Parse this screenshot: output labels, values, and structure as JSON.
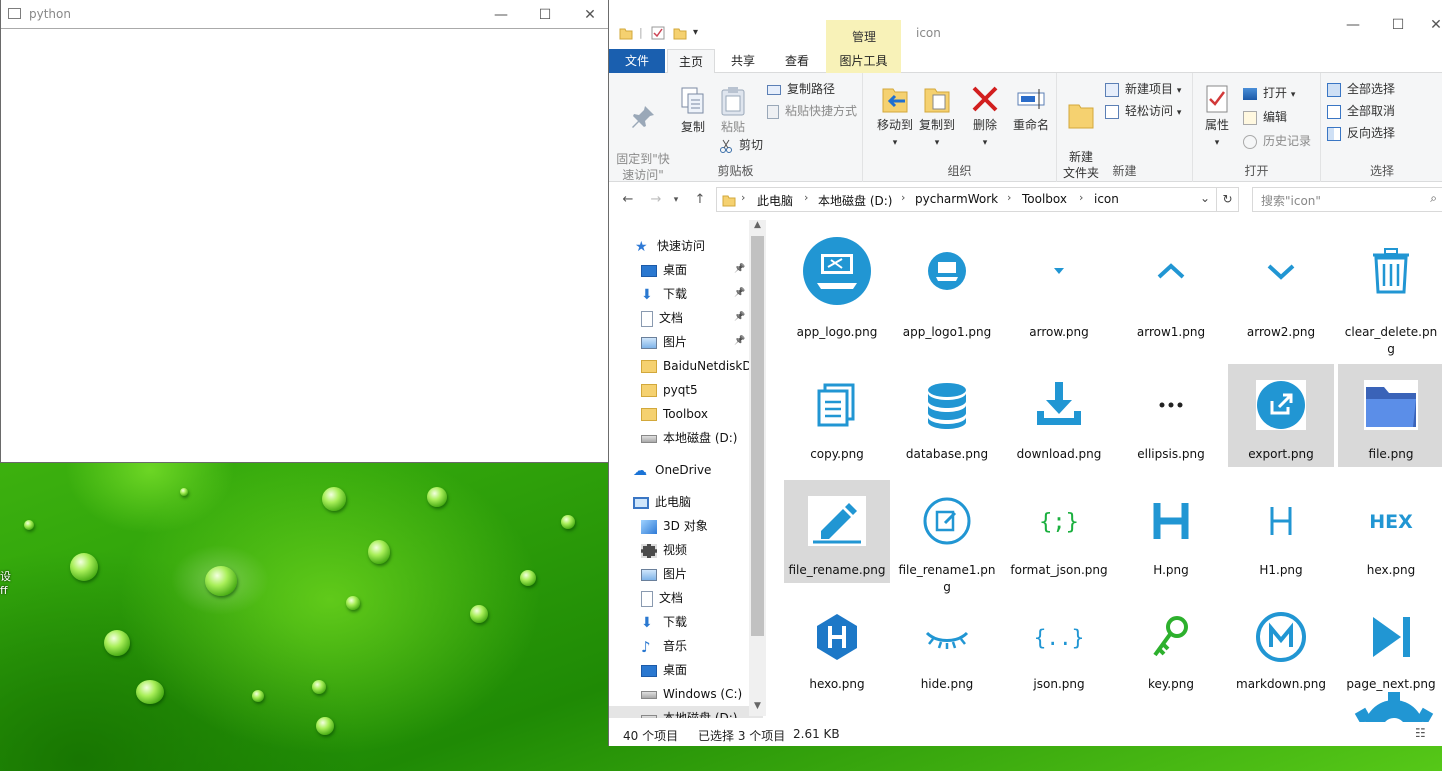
{
  "desktop": {
    "label_fragments": [
      "设",
      "ff"
    ]
  },
  "python_window": {
    "title": "python",
    "controls": {
      "min": "—",
      "max": "☐",
      "close": "✕"
    }
  },
  "explorer": {
    "title": "icon",
    "contextual_tab_group": "管理",
    "window_controls": {
      "min": "—",
      "max": "☐",
      "close": "✕"
    },
    "tabs": {
      "file": "文件",
      "home": "主页",
      "share": "共享",
      "view": "查看",
      "picture_tools": "图片工具"
    },
    "ribbon": {
      "clipboard": {
        "group": "剪贴板",
        "pin_quick": "固定到\"快\n速访问\"",
        "copy": "复制",
        "paste": "粘贴",
        "copy_path": "复制路径",
        "paste_shortcut": "粘贴快捷方式",
        "cut": "剪切"
      },
      "organize": {
        "group": "组织",
        "move_to": "移动到",
        "copy_to": "复制到",
        "delete": "删除",
        "rename": "重命名"
      },
      "new": {
        "group": "新建",
        "new_folder": "新建\n文件夹",
        "new_item": "新建项目",
        "easy_access": "轻松访问"
      },
      "open": {
        "group": "打开",
        "properties": "属性",
        "open": "打开",
        "edit": "编辑",
        "history": "历史记录"
      },
      "select": {
        "group": "选择",
        "select_all": "全部选择",
        "select_none": "全部取消",
        "invert": "反向选择"
      }
    },
    "address": {
      "crumbs": [
        "此电脑",
        "本地磁盘 (D:)",
        "pycharmWork",
        "Toolbox",
        "icon"
      ],
      "search_placeholder": "搜索\"icon\""
    },
    "nav": {
      "quick_access": "快速访问",
      "quick_items": [
        {
          "label": "桌面",
          "icon": "desktop-icon",
          "pinned": true
        },
        {
          "label": "下载",
          "icon": "download-icon",
          "pinned": true
        },
        {
          "label": "文档",
          "icon": "document-icon",
          "pinned": true
        },
        {
          "label": "图片",
          "icon": "picture-icon",
          "pinned": true
        },
        {
          "label": "BaiduNetdiskD",
          "icon": "folder-icon",
          "pinned": false
        },
        {
          "label": "pyqt5",
          "icon": "folder-icon",
          "pinned": false
        },
        {
          "label": "Toolbox",
          "icon": "folder-icon",
          "pinned": false
        },
        {
          "label": "本地磁盘 (D:)",
          "icon": "drive-icon",
          "pinned": false
        }
      ],
      "onedrive": "OneDrive",
      "this_pc": "此电脑",
      "pc_items": [
        {
          "label": "3D 对象",
          "icon": "cube-icon"
        },
        {
          "label": "视频",
          "icon": "video-icon"
        },
        {
          "label": "图片",
          "icon": "picture-icon"
        },
        {
          "label": "文档",
          "icon": "document-icon"
        },
        {
          "label": "下载",
          "icon": "download-icon"
        },
        {
          "label": "音乐",
          "icon": "music-icon"
        },
        {
          "label": "桌面",
          "icon": "desktop-icon"
        },
        {
          "label": "Windows (C:)",
          "icon": "drive-icon"
        },
        {
          "label": "本地磁盘 (D:)",
          "icon": "drive-icon"
        }
      ]
    },
    "files": [
      {
        "name": "app_logo.png",
        "icon": "app-logo-icon",
        "selected": false
      },
      {
        "name": "app_logo1.png",
        "icon": "app-logo-small-icon",
        "selected": false
      },
      {
        "name": "arrow.png",
        "icon": "arrow-down-small-icon",
        "selected": false
      },
      {
        "name": "arrow1.png",
        "icon": "chevron-up-icon",
        "selected": false
      },
      {
        "name": "arrow2.png",
        "icon": "chevron-down-icon",
        "selected": false
      },
      {
        "name": "clear_delete.png",
        "icon": "trash-icon",
        "selected": false
      },
      {
        "name": "copy.png",
        "icon": "copy-icon",
        "selected": false
      },
      {
        "name": "database.png",
        "icon": "database-icon",
        "selected": false
      },
      {
        "name": "download.png",
        "icon": "download-tray-icon",
        "selected": false
      },
      {
        "name": "ellipsis.png",
        "icon": "ellipsis-icon",
        "selected": false
      },
      {
        "name": "export.png",
        "icon": "export-icon",
        "selected": true
      },
      {
        "name": "file.png",
        "icon": "folder-blue-icon",
        "selected": true
      },
      {
        "name": "file_rename.png",
        "icon": "pencil-icon",
        "selected": true
      },
      {
        "name": "file_rename1.png",
        "icon": "edit-circle-icon",
        "selected": false
      },
      {
        "name": "format_json.png",
        "icon": "format-json-icon",
        "selected": false
      },
      {
        "name": "H.png",
        "icon": "h-bold-icon",
        "selected": false
      },
      {
        "name": "H1.png",
        "icon": "h-thin-icon",
        "selected": false
      },
      {
        "name": "hex.png",
        "icon": "hex-icon",
        "selected": false
      },
      {
        "name": "hexo.png",
        "icon": "hexo-icon",
        "selected": false
      },
      {
        "name": "hide.png",
        "icon": "eye-closed-icon",
        "selected": false
      },
      {
        "name": "json.png",
        "icon": "json-icon",
        "selected": false
      },
      {
        "name": "key.png",
        "icon": "key-icon",
        "selected": false
      },
      {
        "name": "markdown.png",
        "icon": "markdown-icon",
        "selected": false
      },
      {
        "name": "page_next.png",
        "icon": "page-next-icon",
        "selected": false
      }
    ],
    "status": {
      "count": "40 个项目",
      "selection": "已选择 3 个项目",
      "size": "2.61 KB"
    }
  }
}
